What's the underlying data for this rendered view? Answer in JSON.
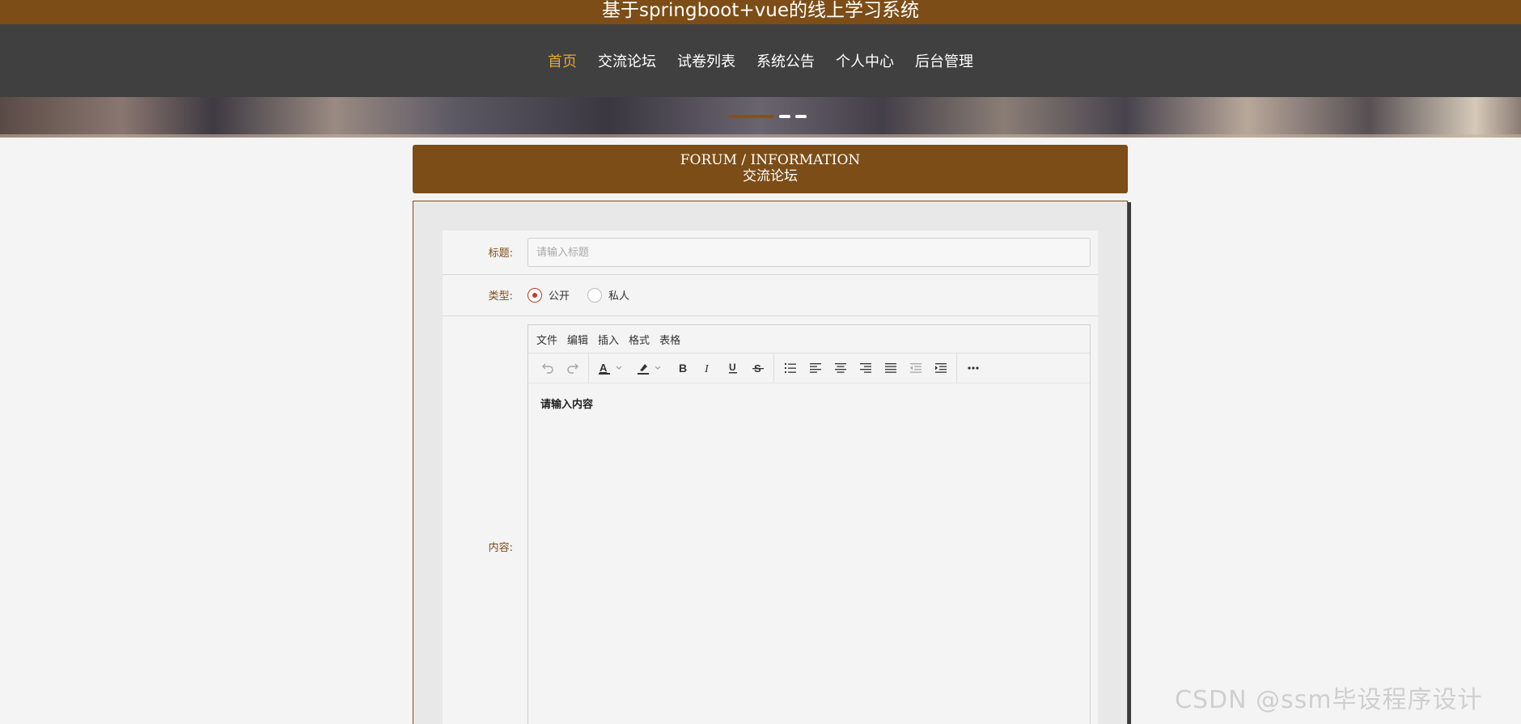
{
  "site": {
    "title": "基于springboot+vue的线上学习系统"
  },
  "nav": {
    "items": [
      {
        "label": "首页",
        "active": true
      },
      {
        "label": "交流论坛",
        "active": false
      },
      {
        "label": "试卷列表",
        "active": false
      },
      {
        "label": "系统公告",
        "active": false
      },
      {
        "label": "个人中心",
        "active": false
      },
      {
        "label": "后台管理",
        "active": false
      }
    ]
  },
  "carousel": {
    "slides": 3,
    "active_index": 0
  },
  "section": {
    "title_en": "FORUM / INFORMATION",
    "title_cn": "交流论坛"
  },
  "form": {
    "title_label": "标题:",
    "title_placeholder": "请输入标题",
    "type_label": "类型:",
    "type_options": [
      "公开",
      "私人"
    ],
    "type_selected": "公开",
    "content_label": "内容:",
    "editor": {
      "menus": [
        "文件",
        "编辑",
        "插入",
        "格式",
        "表格"
      ],
      "toolbar_icons": [
        "undo-icon",
        "redo-icon",
        "text-color-icon",
        "highlight-color-icon",
        "bold-icon",
        "italic-icon",
        "underline-icon",
        "strikethrough-icon",
        "bullet-list-icon",
        "align-left-icon",
        "align-center-icon",
        "align-right-icon",
        "align-justify-icon",
        "outdent-icon",
        "indent-icon",
        "more-icon"
      ],
      "content_placeholder": "请输入内容"
    }
  },
  "watermark": "CSDN @ssm毕设程序设计",
  "colors": {
    "brand": "#7c4d17",
    "nav_bg": "#404040",
    "active_nav": "#e4a62b",
    "radio_checked": "#c23b22"
  }
}
